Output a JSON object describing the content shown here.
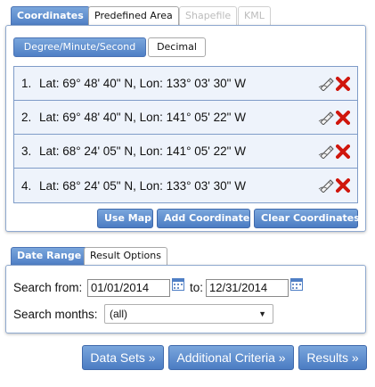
{
  "spatial_tabs": [
    {
      "label": "Coordinates",
      "state": "active"
    },
    {
      "label": "Predefined Area",
      "state": "normal"
    },
    {
      "label": "Shapefile",
      "state": "disabled"
    },
    {
      "label": "KML",
      "state": "disabled"
    }
  ],
  "format_tabs": [
    {
      "label": "Degree/Minute/Second",
      "state": "active"
    },
    {
      "label": "Decimal",
      "state": "normal"
    }
  ],
  "coordinates": [
    {
      "index": "1.",
      "text": "Lat: 69° 48' 40\" N, Lon: 133° 03' 30\" W"
    },
    {
      "index": "2.",
      "text": "Lat: 69° 48' 40\" N, Lon: 141° 05' 22\" W"
    },
    {
      "index": "3.",
      "text": "Lat: 68° 24' 05\" N, Lon: 141° 05' 22\" W"
    },
    {
      "index": "4.",
      "text": "Lat: 68° 24' 05\" N, Lon: 133° 03' 30\" W"
    }
  ],
  "coord_buttons": {
    "use_map": "Use Map",
    "add": "Add Coordinate",
    "clear": "Clear Coordinates"
  },
  "date_tabs": [
    {
      "label": "Date Range",
      "state": "active"
    },
    {
      "label": "Result Options",
      "state": "normal"
    }
  ],
  "date_range": {
    "from_label": "Search from:",
    "from_value": "01/01/2014",
    "to_label": "to:",
    "to_value": "12/31/2014",
    "months_label": "Search months:",
    "months_value": "(all)"
  },
  "nav_buttons": {
    "data_sets": "Data Sets »",
    "additional": "Additional Criteria »",
    "results": "Results »"
  },
  "colors": {
    "accent": "#4f7fc5",
    "row_bg": "#eef3fb",
    "delete_red": "#d0160c"
  }
}
